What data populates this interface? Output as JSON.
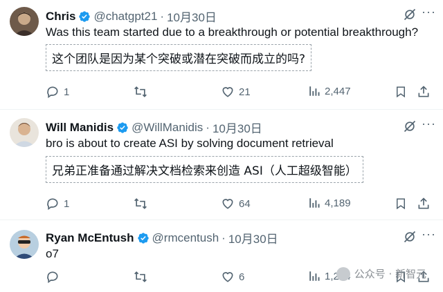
{
  "tweets": [
    {
      "name": "Chris",
      "handle": "@chatgpt21",
      "dot": "·",
      "date": "10月30日",
      "text": "Was this team started due to a breakthrough or potential breakthrough?",
      "translation": "这个团队是因为某个突破或潜在突破而成立的吗?",
      "replies": "1",
      "retweets": "",
      "likes": "21",
      "views": "2,447"
    },
    {
      "name": "Will Manidis",
      "handle": "@WillManidis",
      "dot": "·",
      "date": "10月30日",
      "text": "bro is about to create ASI by solving document retrieval",
      "translation": "兄弟正准备通过解决文档检索来创造 ASI（人工超级智能）",
      "replies": "1",
      "retweets": "",
      "likes": "64",
      "views": "4,189"
    },
    {
      "name": "Ryan McEntush",
      "handle": "@rmcentush",
      "dot": "·",
      "date": "10月30日",
      "text": "o7",
      "replies": "",
      "retweets": "",
      "likes": "6",
      "views": "1,214"
    }
  ],
  "icons": {
    "verified": "verified-badge-icon",
    "grok": "grok-icon",
    "more": "more-icon",
    "reply": "reply-icon",
    "retweet": "retweet-icon",
    "like": "heart-icon",
    "views": "views-icon",
    "bookmark": "bookmark-icon",
    "share": "share-icon"
  },
  "colors": {
    "verified": "#1d9bf0",
    "text": "#0f1419",
    "muted": "#536471",
    "divider": "#eff3f4"
  },
  "watermark": "公众号 · 新智元"
}
